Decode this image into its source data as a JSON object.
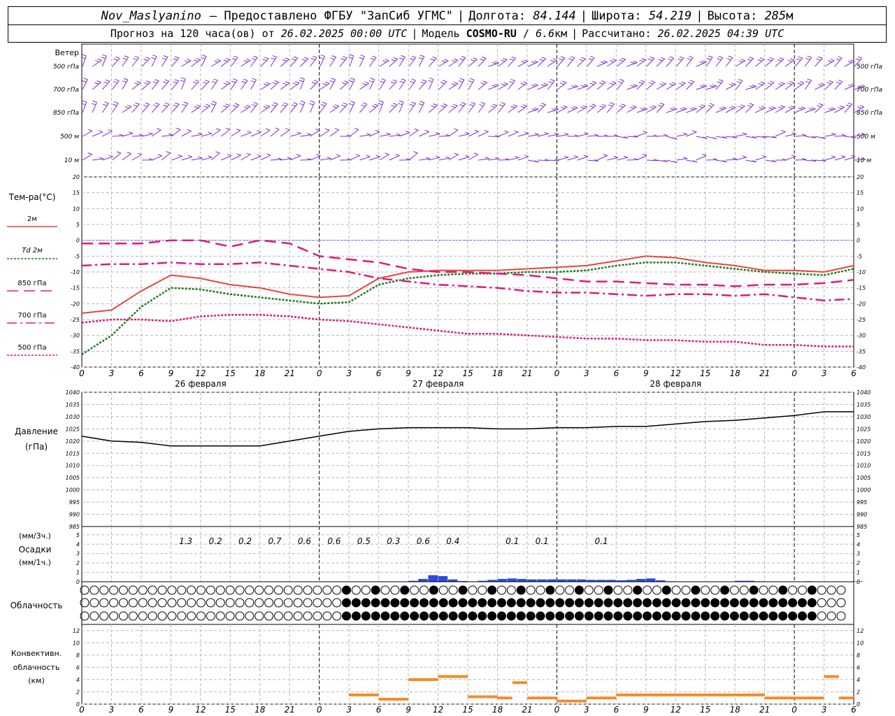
{
  "header": {
    "station": "Nov_Maslyanino",
    "provider": "— Предоставлено ФГБУ \"ЗапСиб УГМС\"",
    "lon_label": "Долгота:",
    "lon": "84.144",
    "lat_label": "Широта:",
    "lat": "54.219",
    "alt_label": "Высота:",
    "alt": "285",
    "alt_unit": "м",
    "forecast_label": "Прогноз на 120 часа(ов) от",
    "forecast_start": "26.02.2025 00:00 UTC",
    "model_label": "Модель",
    "model": "COSMO-RU",
    "resolution": "6.6",
    "res_unit": "км",
    "calc_label": "Рассчитано:",
    "calc_time": "26.02.2025 04:39 UTC"
  },
  "wind_panel": {
    "title": "Ветер",
    "levels": [
      "500 гПа",
      "700 гПа",
      "850 гПа",
      "500 м",
      "10  м"
    ],
    "barb_color": "#7b2fd0"
  },
  "temp_panel": {
    "title": "Тем-ра(°С)",
    "legend": [
      {
        "label": "2м",
        "color": "#e8453c"
      },
      {
        "label": "Td  2м",
        "color": "#1a7a1a"
      },
      {
        "label": "850 гПа",
        "color": "#e0197d"
      },
      {
        "label": "700 гПа",
        "color": "#e0197d"
      },
      {
        "label": "500 гПа",
        "color": "#e0197d"
      }
    ]
  },
  "pressure_panel": {
    "title": "Давление",
    "unit": "(гПа)"
  },
  "precip_panel": {
    "unit_top": "(мм/3ч.)",
    "title": "Осадки",
    "unit_bottom": "(мм/1ч.)"
  },
  "cloud_panel": {
    "title": "Облачность"
  },
  "conv_panel": {
    "title": "Конвективн.",
    "title2": "облачность",
    "unit": "(км)"
  },
  "x_axis": {
    "hour_labels": [
      "0",
      "3",
      "6",
      "9",
      "12",
      "15",
      "18",
      "21",
      "0",
      "3",
      "6",
      "9",
      "12",
      "15",
      "18",
      "21",
      "0",
      "3",
      "6",
      "9",
      "12",
      "15",
      "18",
      "21",
      "0",
      "3",
      "6"
    ],
    "date_labels": [
      "26 февраля",
      "27 февраля",
      "28 февраля"
    ]
  },
  "chart_data": [
    {
      "type": "line",
      "name": "temperature",
      "x_hours": [
        0,
        3,
        6,
        9,
        12,
        15,
        18,
        21,
        24,
        27,
        30,
        33,
        36,
        39,
        42,
        45,
        48,
        51,
        54,
        57,
        60,
        63,
        66,
        69,
        72,
        75,
        78
      ],
      "ylim": [
        -40,
        20
      ],
      "yticks": [
        20,
        15,
        10,
        5,
        0,
        -5,
        -10,
        -15,
        -20,
        -25,
        -30,
        -35,
        -40
      ],
      "series": [
        {
          "name": "2м",
          "values": [
            -23,
            -22,
            -16,
            -11,
            -12,
            -14,
            -15,
            -17,
            -18,
            -17.5,
            -12,
            -10,
            -9.5,
            -9.5,
            -9.5,
            -9,
            -8.5,
            -8,
            -6.5,
            -5,
            -5.5,
            -7,
            -8,
            -9.5,
            -9.5,
            -10,
            -8
          ]
        },
        {
          "name": "Td  2м",
          "values": [
            -36,
            -30,
            -21,
            -15,
            -15.5,
            -17,
            -18,
            -19,
            -20,
            -19.5,
            -14,
            -12,
            -11,
            -10.5,
            -10.5,
            -10,
            -10,
            -9.5,
            -8,
            -7,
            -7,
            -8,
            -9,
            -10,
            -10.5,
            -11,
            -9
          ]
        },
        {
          "name": "850 гПа",
          "values": [
            -1,
            -1,
            -1,
            0,
            0,
            -2,
            0,
            -1,
            -5,
            -6,
            -7,
            -9,
            -10,
            -10,
            -10.5,
            -11,
            -12,
            -13,
            -13,
            -13.5,
            -14,
            -14,
            -14.5,
            -14,
            -14,
            -13.5,
            -12.5
          ]
        },
        {
          "name": "700 гПа",
          "values": [
            -8,
            -7.5,
            -7.5,
            -7,
            -7.5,
            -7.5,
            -7,
            -8,
            -9,
            -10,
            -12,
            -13,
            -14,
            -14.5,
            -15,
            -16,
            -16.5,
            -16.5,
            -17,
            -17.5,
            -17,
            -17,
            -17.5,
            -17,
            -18,
            -19,
            -18.5
          ]
        },
        {
          "name": "500 гПа",
          "values": [
            -26,
            -25,
            -25,
            -25.5,
            -24,
            -23.5,
            -23.5,
            -24,
            -25,
            -25.5,
            -26.5,
            -27.5,
            -28.5,
            -29.5,
            -29.5,
            -30,
            -30.5,
            -31,
            -31,
            -31.5,
            -31.5,
            -32,
            -32,
            -33,
            -33,
            -33.5,
            -33.5
          ]
        }
      ]
    },
    {
      "type": "line",
      "name": "pressure",
      "x_hours": [
        0,
        3,
        6,
        9,
        12,
        15,
        18,
        21,
        24,
        27,
        30,
        33,
        36,
        39,
        42,
        45,
        48,
        51,
        54,
        57,
        60,
        63,
        66,
        69,
        72,
        75,
        78
      ],
      "ylim": [
        985,
        1040
      ],
      "yticks": [
        1040,
        1035,
        1030,
        1025,
        1020,
        1015,
        1010,
        1005,
        1000,
        995,
        990,
        985
      ],
      "series": [
        {
          "values": [
            1022,
            1020,
            1019.5,
            1018,
            1018,
            1018,
            1018,
            1020,
            1022,
            1024,
            1025,
            1025.5,
            1025.5,
            1025.5,
            1025,
            1025,
            1025.5,
            1025.5,
            1026,
            1026,
            1027,
            1028,
            1028.5,
            1029.5,
            1030.5,
            1032,
            1032
          ]
        }
      ]
    },
    {
      "type": "bar",
      "name": "precipitation",
      "ylim": [
        0,
        5
      ],
      "yticks": [
        5,
        4,
        3,
        2,
        1,
        0
      ],
      "labels_3h": [
        {
          "hour": 10.5,
          "text": "1.3"
        },
        {
          "hour": 13.5,
          "text": "0.2"
        },
        {
          "hour": 16.5,
          "text": "0.2"
        },
        {
          "hour": 19.5,
          "text": "0.7"
        },
        {
          "hour": 22.5,
          "text": "0.6"
        },
        {
          "hour": 25.5,
          "text": "0.6"
        },
        {
          "hour": 28.5,
          "text": "0.5"
        },
        {
          "hour": 31.5,
          "text": "0.3"
        },
        {
          "hour": 34.5,
          "text": "0.6"
        },
        {
          "hour": 37.5,
          "text": "0.4"
        },
        {
          "hour": 43.5,
          "text": "0.1"
        },
        {
          "hour": 46.5,
          "text": "0.1"
        },
        {
          "hour": 52.5,
          "text": "0.1"
        }
      ],
      "hourly": [
        [
          33,
          0.1
        ],
        [
          34,
          0.3
        ],
        [
          35,
          0.7
        ],
        [
          36,
          0.6
        ],
        [
          37,
          0.25
        ],
        [
          38,
          0.08
        ],
        [
          40,
          0.1
        ],
        [
          41,
          0.2
        ],
        [
          42,
          0.3
        ],
        [
          43,
          0.35
        ],
        [
          44,
          0.3
        ],
        [
          45,
          0.25
        ],
        [
          46,
          0.25
        ],
        [
          47,
          0.25
        ],
        [
          48,
          0.25
        ],
        [
          49,
          0.25
        ],
        [
          50,
          0.25
        ],
        [
          51,
          0.2
        ],
        [
          52,
          0.2
        ],
        [
          53,
          0.2
        ],
        [
          54,
          0.15
        ],
        [
          55,
          0.2
        ],
        [
          56,
          0.3
        ],
        [
          57,
          0.35
        ],
        [
          58,
          0.15
        ],
        [
          59,
          0.05
        ],
        [
          66,
          0.1
        ],
        [
          67,
          0.1
        ],
        [
          68,
          0.05
        ],
        [
          73,
          0.05
        ],
        [
          78,
          0.05
        ]
      ],
      "color": "#2a4be0"
    },
    {
      "type": "bar",
      "name": "convective_cloud",
      "ylim": [
        0,
        13
      ],
      "yticks": [
        12,
        10,
        8,
        6,
        4,
        2,
        0
      ],
      "segments": [
        [
          27,
          30,
          1.5
        ],
        [
          30,
          33,
          0.8
        ],
        [
          33,
          36,
          4
        ],
        [
          36,
          39,
          4.5
        ],
        [
          39,
          42,
          1.2
        ],
        [
          42,
          43.5,
          1
        ],
        [
          43.5,
          45,
          3.5
        ],
        [
          45,
          48,
          1
        ],
        [
          48,
          51,
          0.5
        ],
        [
          51,
          54,
          1
        ],
        [
          54,
          57,
          1.5
        ],
        [
          57,
          60,
          1.5
        ],
        [
          60,
          63,
          1.5
        ],
        [
          63,
          66,
          1.5
        ],
        [
          66,
          69,
          1.5
        ],
        [
          69,
          72,
          1
        ],
        [
          72,
          75,
          1
        ],
        [
          75,
          76.5,
          4.5
        ],
        [
          76.5,
          78,
          1
        ]
      ],
      "color": "#f28c28"
    },
    {
      "type": "table",
      "name": "cloud_cover",
      "rows": [
        "upper",
        "middle",
        "lower"
      ],
      "values": [
        [
          0,
          0,
          0,
          0,
          0,
          0,
          0,
          0,
          0,
          0,
          0,
          0,
          0,
          0,
          0,
          0,
          0,
          0,
          0,
          0,
          0,
          0,
          0,
          0,
          0,
          0,
          0,
          0,
          0,
          0,
          0,
          0,
          0,
          0,
          0,
          0,
          0,
          0,
          0,
          0,
          0,
          0,
          0,
          0,
          0,
          0,
          0,
          0,
          0,
          0,
          0,
          0,
          0,
          0,
          0,
          0,
          0,
          0,
          0,
          0,
          0,
          0,
          0,
          0,
          0,
          0,
          0,
          0,
          0,
          0,
          0,
          0,
          0,
          0,
          0,
          0,
          0,
          0,
          0
        ],
        [
          0,
          0,
          0,
          0,
          0,
          0,
          0,
          0,
          0,
          0,
          0,
          0,
          0,
          0,
          0,
          0,
          0,
          0,
          0,
          0,
          0,
          0,
          0,
          0,
          0,
          0,
          0,
          0,
          0,
          0,
          0,
          0,
          0,
          0,
          0,
          0,
          0,
          0,
          0,
          0,
          0,
          0,
          0,
          0,
          0,
          0,
          0,
          0,
          0,
          0,
          0,
          0,
          0,
          0,
          0,
          0,
          0,
          0,
          0,
          0,
          0,
          0,
          0,
          0,
          0,
          0,
          0,
          0,
          0,
          0,
          0,
          0,
          0,
          0,
          0,
          0,
          0,
          0,
          0
        ],
        [
          0,
          0,
          0,
          0,
          0,
          0,
          0,
          0,
          0,
          0,
          0,
          0,
          0,
          0,
          0,
          0,
          0,
          0,
          0,
          0,
          0,
          0,
          0,
          0,
          0,
          0,
          0,
          0,
          0,
          0,
          0,
          0,
          0,
          0,
          0,
          0,
          0,
          0,
          0,
          0,
          0,
          0,
          0,
          0,
          0,
          0,
          0,
          0,
          0,
          0,
          0,
          0,
          0,
          0,
          0,
          0,
          0,
          0,
          0,
          0,
          0,
          0,
          0,
          0,
          0,
          0,
          0,
          0,
          0,
          0,
          0,
          0,
          0,
          0,
          0,
          0,
          0,
          0,
          0
        ]
      ]
    }
  ]
}
